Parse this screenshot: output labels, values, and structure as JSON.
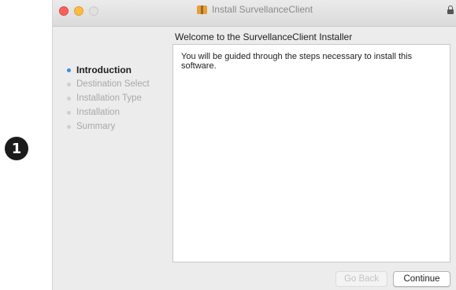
{
  "step_badge": "1",
  "window": {
    "title": "Install SurvellanceClient",
    "heading": "Welcome to the SurvellanceClient Installer"
  },
  "sidebar": {
    "items": [
      {
        "label": "Introduction",
        "active": true
      },
      {
        "label": "Destination Select",
        "active": false
      },
      {
        "label": "Installation Type",
        "active": false
      },
      {
        "label": "Installation",
        "active": false
      },
      {
        "label": "Summary",
        "active": false
      }
    ]
  },
  "content": {
    "text": "You will be guided through the steps necessary to install this software."
  },
  "buttons": {
    "back_label": "Go Back",
    "continue_label": "Continue"
  },
  "colors": {
    "accent": "#3b8de8",
    "close": "#fc605c",
    "minimize": "#fdbc40"
  },
  "icons": [
    "package-icon",
    "lock-icon"
  ]
}
